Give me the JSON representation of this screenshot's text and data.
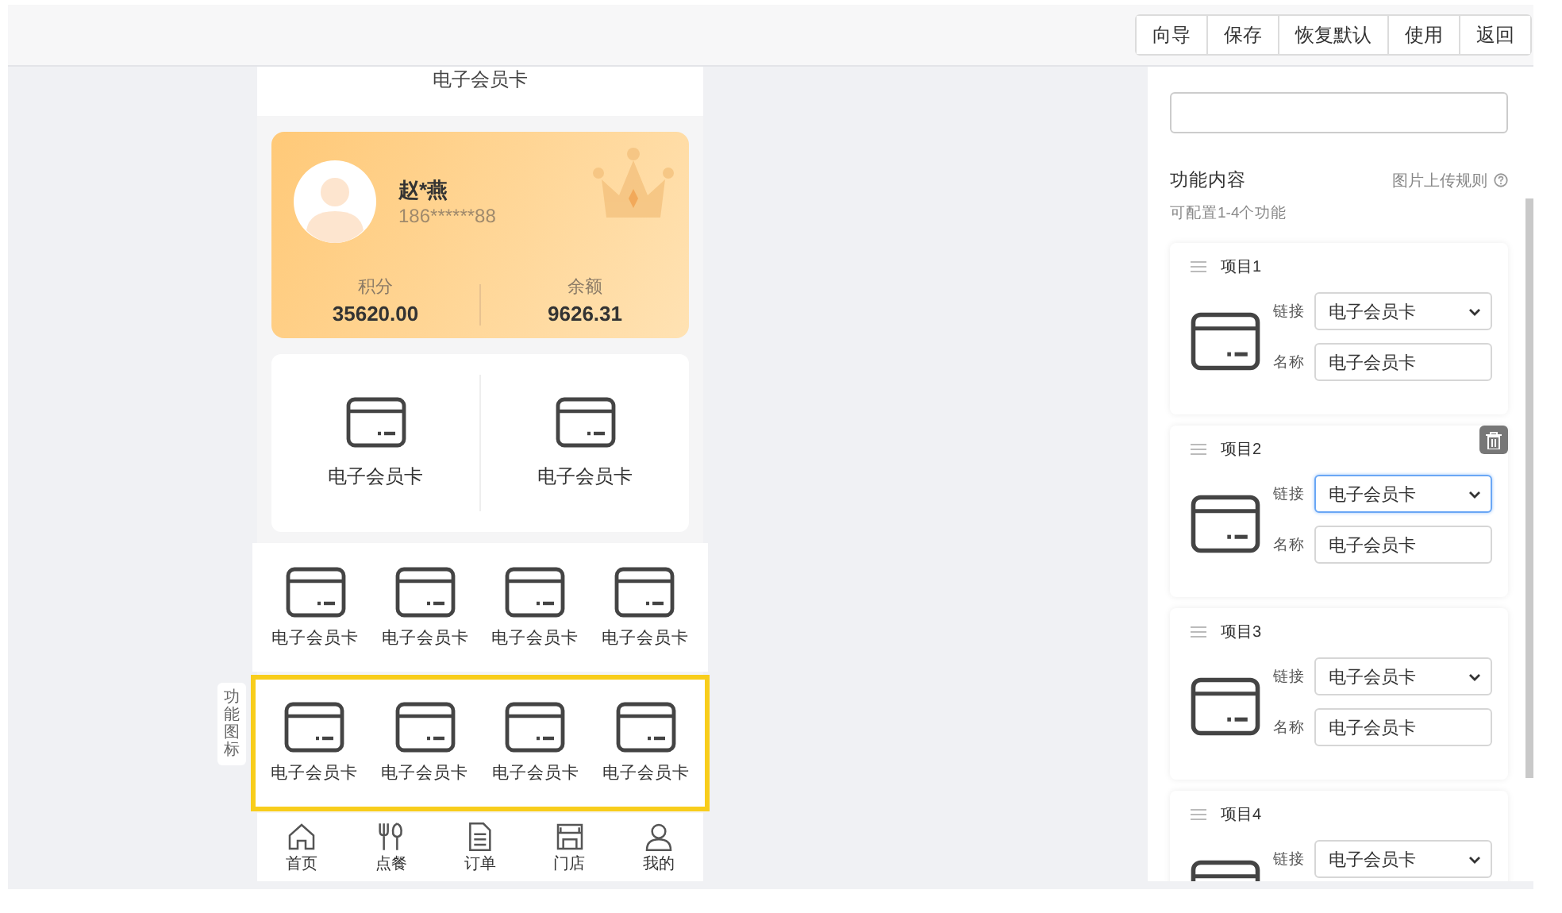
{
  "toolbar": {
    "buttons": [
      "向导",
      "保存",
      "恢复默认",
      "使用",
      "返回"
    ]
  },
  "preview": {
    "page_title": "电子会员卡",
    "member": {
      "name": "赵*燕",
      "phone": "186******88",
      "stats": [
        {
          "label": "积分",
          "value": "35620.00"
        },
        {
          "label": "余额",
          "value": "9626.31"
        }
      ]
    },
    "large_entries": [
      {
        "label": "电子会员卡"
      },
      {
        "label": "电子会员卡"
      }
    ],
    "icon_rows": [
      {
        "selected": false,
        "items": [
          {
            "label": "电子会员卡"
          },
          {
            "label": "电子会员卡"
          },
          {
            "label": "电子会员卡"
          },
          {
            "label": "电子会员卡"
          }
        ]
      },
      {
        "selected": true,
        "items": [
          {
            "label": "电子会员卡"
          },
          {
            "label": "电子会员卡"
          },
          {
            "label": "电子会员卡"
          },
          {
            "label": "电子会员卡"
          }
        ]
      }
    ],
    "side_tag": "功能图标",
    "tab_bar": [
      {
        "label": "首页",
        "kind": "home"
      },
      {
        "label": "点餐",
        "kind": "cutlery"
      },
      {
        "label": "订单",
        "kind": "document"
      },
      {
        "label": "门店",
        "kind": "store"
      },
      {
        "label": "我的",
        "kind": "person"
      }
    ]
  },
  "panel": {
    "section_title": "功能内容",
    "rule_link": "图片上传规则",
    "hint": "可配置1-4个功能",
    "items": [
      {
        "title": "项目1",
        "link_label": "链接",
        "link_value": "电子会员卡",
        "link_focused": false,
        "name_label": "名称",
        "name_value": "电子会员卡",
        "delete_shown": false
      },
      {
        "title": "项目2",
        "link_label": "链接",
        "link_value": "电子会员卡",
        "link_focused": true,
        "name_label": "名称",
        "name_value": "电子会员卡",
        "delete_shown": true
      },
      {
        "title": "项目3",
        "link_label": "链接",
        "link_value": "电子会员卡",
        "link_focused": false,
        "name_label": "名称",
        "name_value": "电子会员卡",
        "delete_shown": false
      },
      {
        "title": "项目4",
        "link_label": "链接",
        "link_value": "电子会员卡",
        "link_focused": false,
        "delete_shown": false
      }
    ]
  }
}
